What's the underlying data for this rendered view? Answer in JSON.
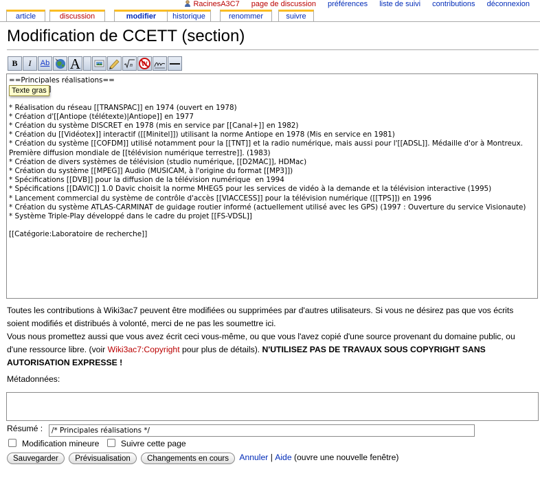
{
  "personal": {
    "user": "RacinesA3C7",
    "talk": "page de discussion",
    "preferences": "préférences",
    "watchlist": "liste de suivi",
    "contributions": "contributions",
    "logout": "déconnexion"
  },
  "tabs": [
    {
      "label": "article"
    },
    {
      "label": "discussion"
    },
    {
      "label": "modifier"
    },
    {
      "label": "historique"
    },
    {
      "label": "renommer"
    },
    {
      "label": "suivre"
    }
  ],
  "title": "Modification de CCETT (section)",
  "toolbar": {
    "bold": "B",
    "italic": "I",
    "link": "Ab",
    "headline": "A",
    "tooltip": "Texte gras"
  },
  "editor": {
    "content": "==Principales réalisations==\n[Texte gras]\n\n* Réalisation du réseau [[TRANSPAC]] en 1974 (ouvert en 1978)\n* Création d'[[Antiope (télétexte)|Antiope]] en 1977\n* Création du système DISCRET en 1978 (mis en service par [[Canal+]] en 1982)\n* Création du [[Vidéotex]] interactif ([[Minitel]]) utilisant la norme Antiope en 1978 (Mis en service en 1981)\n* Création du système [[COFDM]] utilisé notamment pour la [[TNT]] et la radio numérique, mais aussi pour l'[[ADSL]]. Médaille d'or à Montreux. Première diffusion mondiale de [[télévision numérique terrestre]]. (1983)\n* Création de divers systèmes de télévision (studio numérique, [[D2MAC]], HDMac)\n* Création du système [[MPEG]] Audio (MUSICAM, à l'origine du format [[MP3]])\n* Spécifications [[DVB]] pour la diffusion de la télévision numérique  en 1994\n* Spécifications [[DAVIC]] 1.0 Davic choisit la norme MHEG5 pour les services de vidéo à la demande et la télévision interactive (1995)\n* Lancement commercial du système de contrôle d'accès [[VIACCESS]] pour la télévision numérique ([[TPS]]) en 1996\n* Création du système ATLAS-CARMINAT de guidage routier informé (actuellement utilisé avec les GPS) (1997 : Ouverture du service Visionaute)\n* Système Triple-Play développé dans le cadre du projet [[FS-VDSL]]\n\n[[Catégorie:Laboratoire de recherche]]"
  },
  "notice": {
    "line1": "Toutes les contributions à Wiki3ac7 peuvent être modifiées ou supprimées par d'autres utilisateurs. Si vous ne désirez pas que vos écrits soient modifiés et distribués à volonté, merci de ne pas les soumettre ici.",
    "line2_a": "Vous nous promettez aussi que vous avez écrit ceci vous-même, ou que vous l'avez copié d'une source provenant du domaine public, ou d'une ressource libre. (voir ",
    "copyright_link": "Wiki3ac7:Copyright",
    "line2_b": " pour plus de détails). ",
    "warning": "N'UTILISEZ PAS DE TRAVAUX SOUS COPYRIGHT SANS AUTORISATION EXPRESSE !"
  },
  "metadata_label": "Métadonnées:",
  "summary": {
    "label": "Résumé :",
    "value": "/* Principales réalisations */"
  },
  "options": {
    "minor": "Modification mineure",
    "watch": "Suivre cette page"
  },
  "buttons": {
    "save": "Sauvegarder",
    "preview": "Prévisualisation",
    "diff": "Changements en cours",
    "cancel": "Annuler",
    "sep": "|",
    "help": "Aide",
    "help_note": "(ouvre une nouvelle fenêtre)"
  }
}
